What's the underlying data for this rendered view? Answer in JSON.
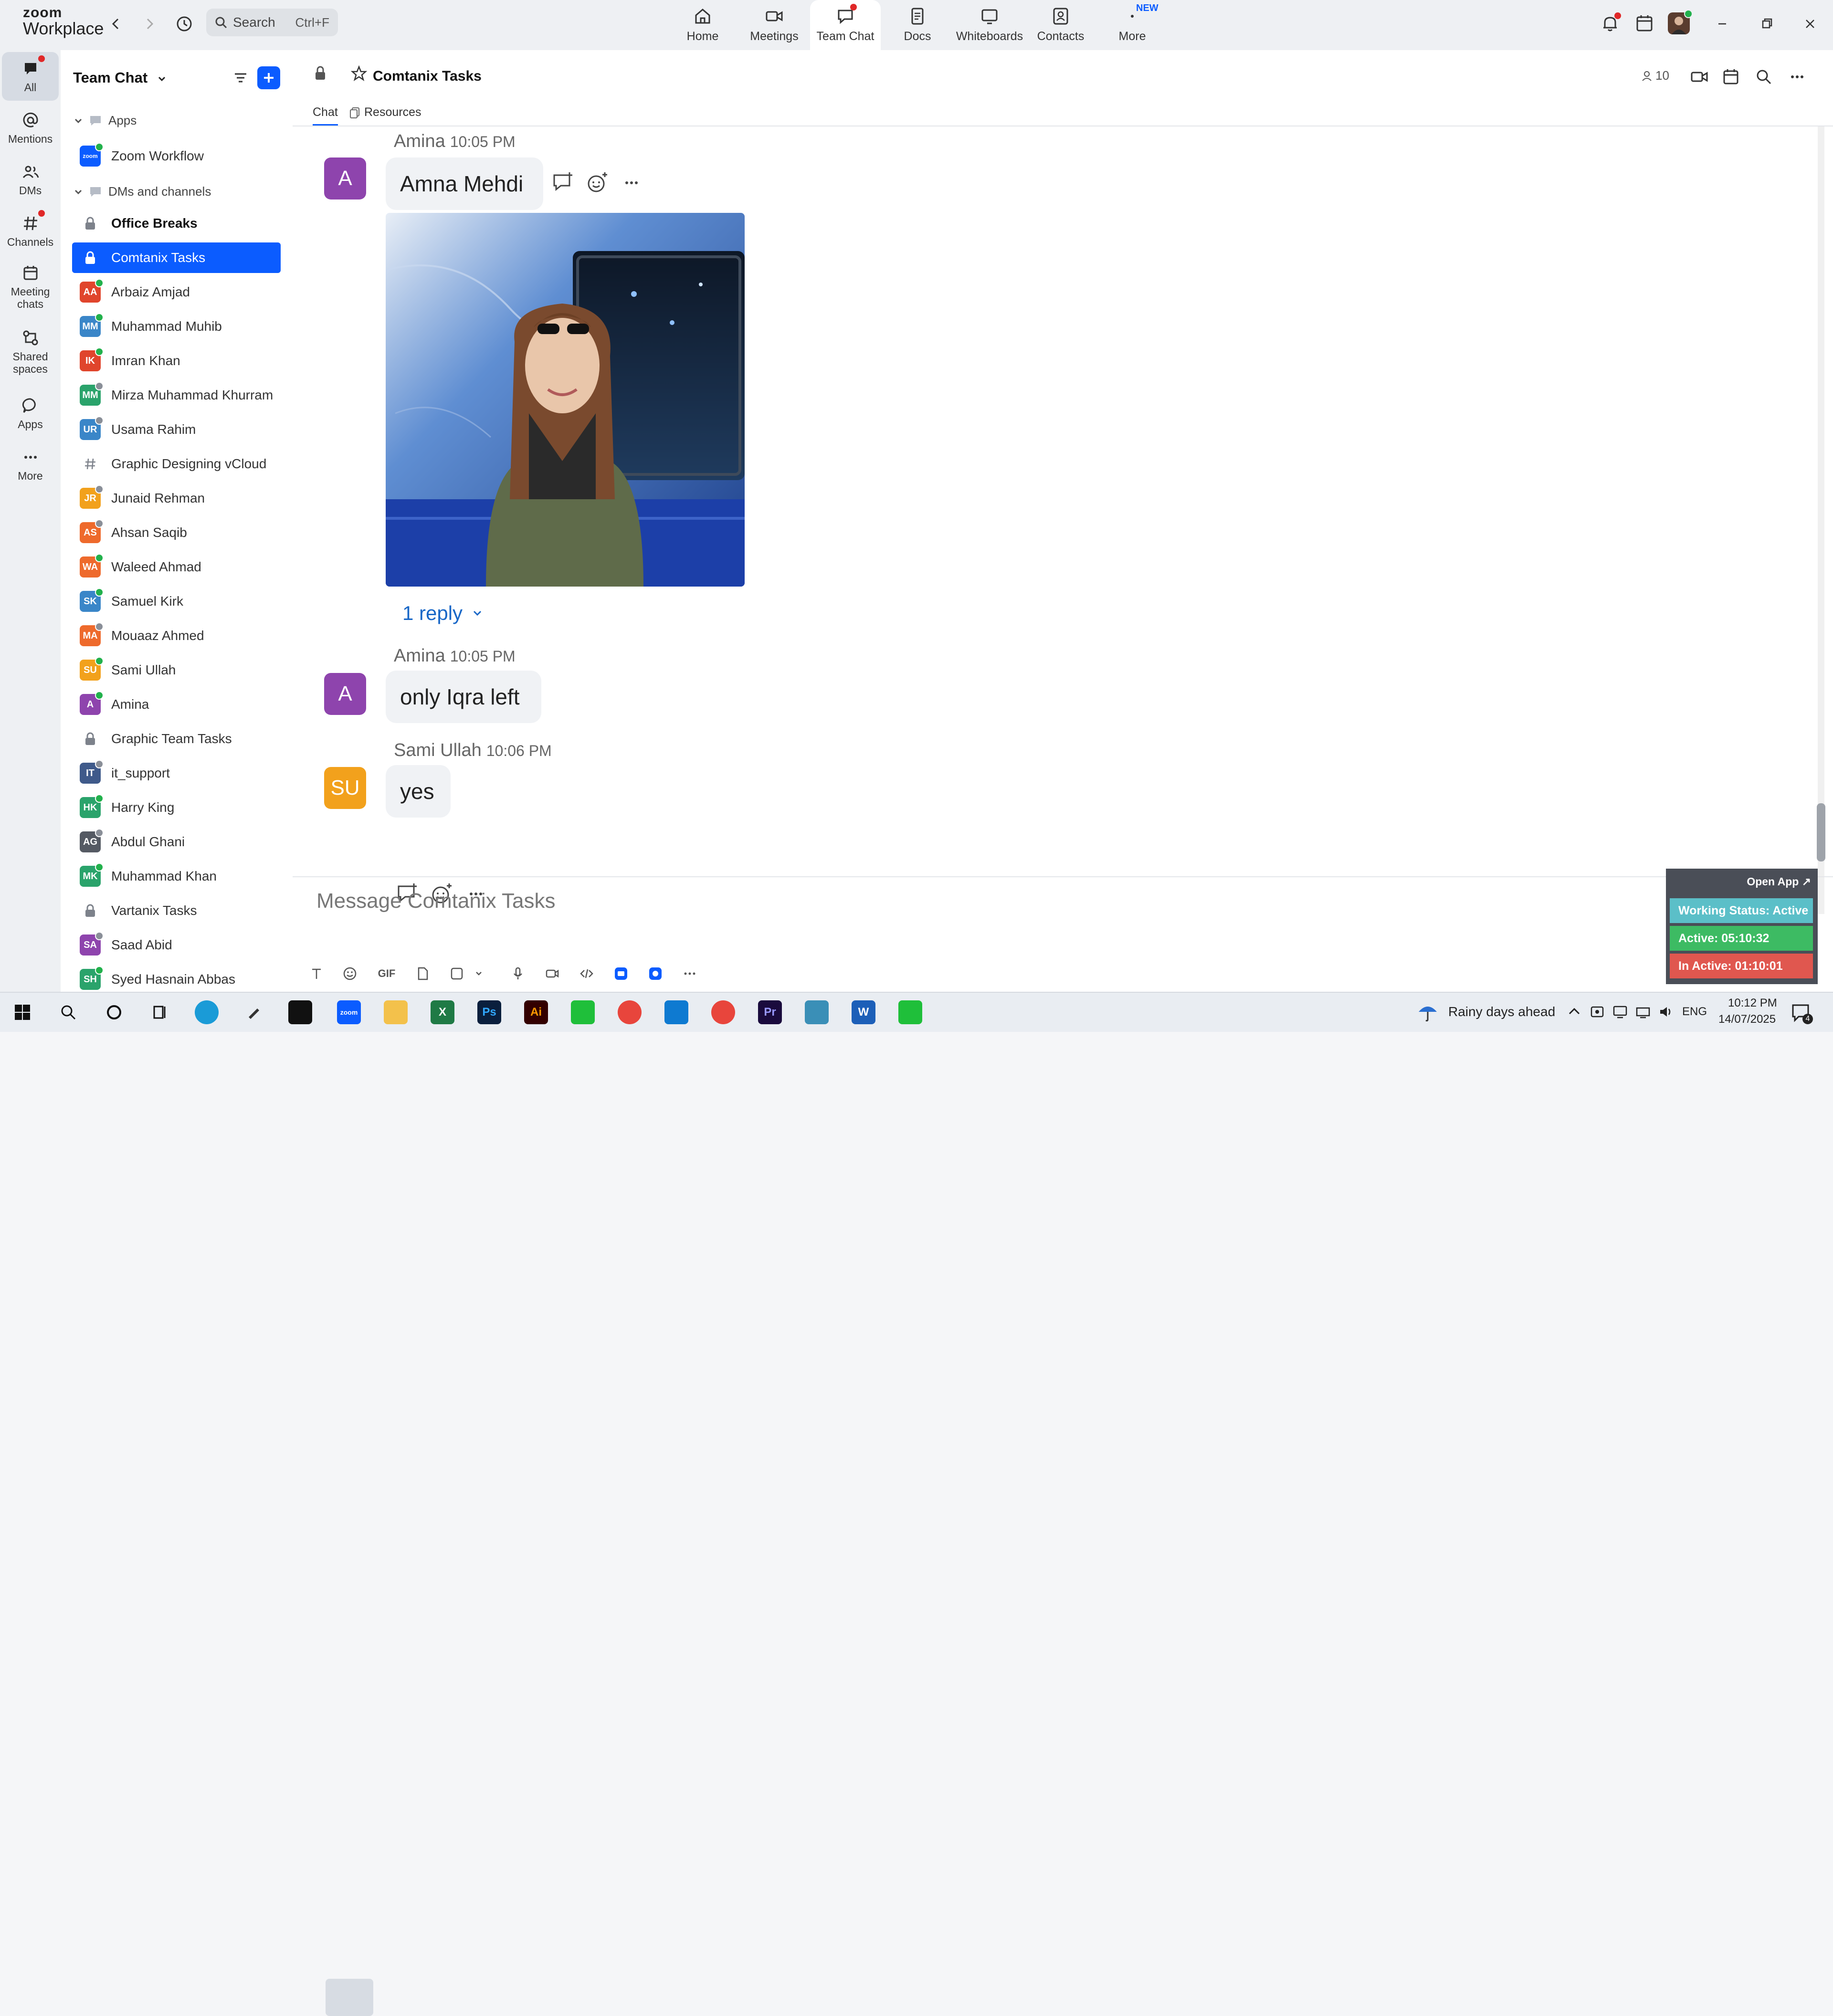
{
  "app": {
    "logo_line1": "zoom",
    "logo_line2": "Workplace",
    "search_label": "Search",
    "search_shortcut": "Ctrl+F",
    "top_tabs": [
      {
        "label": "Home",
        "icon": "home-icon"
      },
      {
        "label": "Meetings",
        "icon": "video-camera-icon"
      },
      {
        "label": "Team Chat",
        "icon": "chat-bubble-icon",
        "active": true
      },
      {
        "label": "Docs",
        "icon": "document-icon"
      },
      {
        "label": "Whiteboards",
        "icon": "whiteboard-icon"
      },
      {
        "label": "Contacts",
        "icon": "contacts-icon"
      },
      {
        "label": "More",
        "icon": "more-icon"
      }
    ],
    "new_badge": "NEW"
  },
  "rail": [
    {
      "label": "All",
      "icon": "chat-icon",
      "active": true
    },
    {
      "label": "Mentions",
      "icon": "at-sign-icon"
    },
    {
      "label": "DMs",
      "icon": "people-icon"
    },
    {
      "label": "Channels",
      "icon": "hash-icon"
    },
    {
      "label": "Meeting chats",
      "icon": "calendar-icon"
    },
    {
      "label": "Shared spaces",
      "icon": "shared-spaces-icon"
    },
    {
      "label": "Apps",
      "icon": "apps-icon"
    },
    {
      "label": "More",
      "icon": "ellipsis-icon"
    }
  ],
  "sidebar": {
    "title": "Team Chat",
    "apps_header": "Apps",
    "apps": [
      {
        "label": "Zoom Workflow",
        "initials": "zoom",
        "color": "#0b5cff"
      }
    ],
    "dms_header": "DMs and channels",
    "items": [
      {
        "label": "Office Breaks",
        "type": "lock",
        "bold": true
      },
      {
        "label": "Comtanix Tasks",
        "type": "lock",
        "selected": true
      },
      {
        "label": "Arbaiz Amjad",
        "initials": "AA",
        "color": "#e0452c",
        "presence": "#22b14c"
      },
      {
        "label": "Muhammad Muhib",
        "initials": "MM",
        "color": "#3a86c8",
        "presence": "#22b14c"
      },
      {
        "label": "Imran Khan",
        "initials": "IK",
        "color": "#e0452c",
        "presence": "#22b14c"
      },
      {
        "label": "Mirza Muhammad Khurram",
        "initials": "MM",
        "color": "#2aa36b",
        "presence": "#8a8f98"
      },
      {
        "label": "Usama Rahim",
        "initials": "UR",
        "color": "#3a86c8",
        "presence": "#8a8f98"
      },
      {
        "label": "Graphic Designing vCloud",
        "type": "hash"
      },
      {
        "label": "Junaid Rehman",
        "initials": "JR",
        "color": "#f2a11c",
        "presence": "#8a8f98"
      },
      {
        "label": "Ahsan Saqib",
        "initials": "AS",
        "color": "#ee6a2c",
        "presence": "#8a8f98"
      },
      {
        "label": "Waleed Ahmad",
        "initials": "WA",
        "color": "#ee6a2c",
        "presence": "#22b14c"
      },
      {
        "label": "Samuel Kirk",
        "initials": "SK",
        "color": "#3a86c8",
        "presence": "#22b14c"
      },
      {
        "label": "Mouaaz Ahmed",
        "initials": "MA",
        "color": "#ee6a2c",
        "presence": "#8a8f98"
      },
      {
        "label": "Sami Ullah",
        "initials": "SU",
        "color": "#f2a11c",
        "presence": "#22b14c"
      },
      {
        "label": "Amina",
        "initials": "A",
        "color": "#8e44ad",
        "presence": "#22b14c"
      },
      {
        "label": "Graphic Team Tasks",
        "type": "lock"
      },
      {
        "label": "it_support",
        "initials": "IT",
        "color": "#3f5a8a",
        "presence": "#8a8f98"
      },
      {
        "label": "Harry King",
        "initials": "HK",
        "color": "#2aa36b",
        "presence": "#22b14c"
      },
      {
        "label": "Abdul Ghani",
        "initials": "AG",
        "color": "#555a63",
        "presence": "#8a8f98"
      },
      {
        "label": "Muhammad Khan",
        "initials": "MK",
        "color": "#2aa36b",
        "presence": "#22b14c"
      },
      {
        "label": "Vartanix Tasks",
        "type": "lock"
      },
      {
        "label": "Saad Abid",
        "initials": "SA",
        "color": "#8e44ad",
        "presence": "#8a8f98"
      },
      {
        "label": "Syed Hasnain Abbas",
        "initials": "SH",
        "color": "#2aa36b",
        "presence": "#22b14c"
      }
    ]
  },
  "channel": {
    "title": "Comtanix Tasks",
    "member_count": "10",
    "tabs": [
      "Chat",
      "Resources"
    ]
  },
  "messages": [
    {
      "sender": "Amina",
      "time": "10:05 PM",
      "initials": "A",
      "color": "#8e44ad",
      "text": "Amna Mehdi",
      "reply_label": "1 reply"
    },
    {
      "sender": "Amina",
      "time": "10:05 PM",
      "initials": "A",
      "color": "#8e44ad",
      "text": "only Iqra left"
    },
    {
      "sender": "Sami Ullah",
      "time": "10:06 PM",
      "initials": "SU",
      "color": "#f2a11c",
      "text": "yes"
    }
  ],
  "composer": {
    "placeholder": "Message Comtanix Tasks",
    "gif_label": "GIF"
  },
  "widget": {
    "open_app": "Open App ↗",
    "status": "Working Status: Active",
    "active": "Active: 05:10:32",
    "inactive": "In Active: 01:10:01",
    "colors": {
      "status": "#5bbfc8",
      "active": "#3dbb63",
      "inactive": "#e0574f"
    }
  },
  "taskbar": {
    "weather": "Rainy days ahead",
    "lang": "ENG",
    "time": "10:12 PM",
    "date": "14/07/2025",
    "notif_count": "4"
  }
}
